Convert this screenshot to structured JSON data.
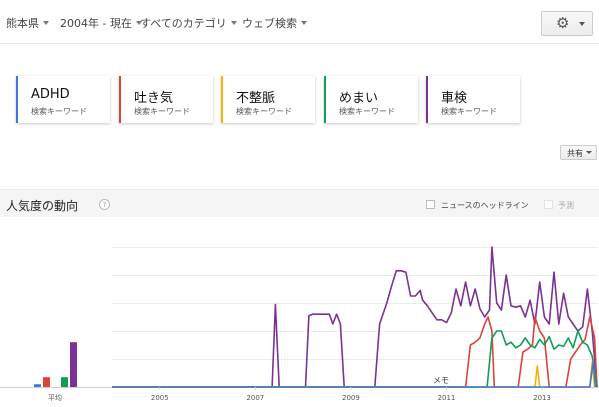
{
  "filters": [
    {
      "label": "熊本県"
    },
    {
      "label": "2004年 - 現在"
    },
    {
      "label": "すべてのカテゴリ"
    },
    {
      "label": "ウェブ検索"
    }
  ],
  "settings": {
    "icon": "gear-icon"
  },
  "terms": [
    {
      "term": "ADHD",
      "type": "検索キーワード",
      "color": "#3c78d8"
    },
    {
      "term": "吐き気",
      "type": "検索キーワード",
      "color": "#db4437"
    },
    {
      "term": "不整脈",
      "type": "検索キーワード",
      "color": "#f4b400"
    },
    {
      "term": "めまい",
      "type": "検索キーワード",
      "color": "#0f9d58"
    },
    {
      "term": "車検",
      "type": "検索キーワード",
      "color": "#7b3294"
    }
  ],
  "share": {
    "label": "共有"
  },
  "interest": {
    "title": "人気度の動向",
    "help": "?",
    "news_label": "ニュースのヘッドライン",
    "forecast_label": "予測"
  },
  "chart_data": {
    "type": "line",
    "x_ticks": [
      "2005",
      "2007",
      "2009",
      "2011",
      "2013"
    ],
    "average_label": "平均",
    "memo_label": "メモ",
    "ylim": [
      0,
      100
    ],
    "grid": true,
    "averages": [
      {
        "name": "ADHD",
        "value": 2
      },
      {
        "name": "吐き気",
        "value": 7
      },
      {
        "name": "不整脈",
        "value": 0
      },
      {
        "name": "めまい",
        "value": 7
      },
      {
        "name": "車検",
        "value": 32
      }
    ],
    "series": [
      {
        "name": "車検",
        "color": "#7b3294",
        "points": [
          [
            2004.0,
            0
          ],
          [
            2007.35,
            0
          ],
          [
            2007.42,
            59
          ],
          [
            2007.5,
            0
          ],
          [
            2008.05,
            0
          ],
          [
            2008.12,
            51
          ],
          [
            2008.2,
            52
          ],
          [
            2008.45,
            52
          ],
          [
            2008.55,
            52
          ],
          [
            2008.62,
            45
          ],
          [
            2008.7,
            52
          ],
          [
            2008.78,
            45
          ],
          [
            2008.86,
            0
          ],
          [
            2009.5,
            0
          ],
          [
            2009.6,
            45
          ],
          [
            2009.75,
            60
          ],
          [
            2009.85,
            72
          ],
          [
            2009.95,
            83
          ],
          [
            2010.05,
            83
          ],
          [
            2010.15,
            82
          ],
          [
            2010.25,
            65
          ],
          [
            2010.35,
            65
          ],
          [
            2010.45,
            69
          ],
          [
            2010.5,
            62
          ],
          [
            2010.6,
            58
          ],
          [
            2010.7,
            53
          ],
          [
            2010.8,
            48
          ],
          [
            2010.9,
            48
          ],
          [
            2011.0,
            46
          ],
          [
            2011.1,
            53
          ],
          [
            2011.2,
            70
          ],
          [
            2011.3,
            58
          ],
          [
            2011.4,
            75
          ],
          [
            2011.5,
            58
          ],
          [
            2011.6,
            70
          ],
          [
            2011.7,
            56
          ],
          [
            2011.8,
            50
          ],
          [
            2011.9,
            55
          ],
          [
            2011.95,
            100
          ],
          [
            2012.05,
            60
          ],
          [
            2012.15,
            55
          ],
          [
            2012.25,
            80
          ],
          [
            2012.35,
            58
          ],
          [
            2012.45,
            57
          ],
          [
            2012.55,
            58
          ],
          [
            2012.65,
            50
          ],
          [
            2012.75,
            62
          ],
          [
            2012.85,
            45
          ],
          [
            2012.95,
            75
          ],
          [
            2013.05,
            50
          ],
          [
            2013.15,
            45
          ],
          [
            2013.25,
            82
          ],
          [
            2013.35,
            45
          ],
          [
            2013.45,
            67
          ],
          [
            2013.55,
            50
          ],
          [
            2013.65,
            45
          ],
          [
            2013.75,
            40
          ],
          [
            2013.85,
            43
          ],
          [
            2013.95,
            70
          ],
          [
            2014.05,
            40
          ],
          [
            2014.15,
            0
          ]
        ]
      },
      {
        "name": "吐き気",
        "color": "#db4437",
        "points": [
          [
            2004.0,
            0
          ],
          [
            2011.4,
            0
          ],
          [
            2011.5,
            30
          ],
          [
            2011.6,
            32
          ],
          [
            2011.7,
            35
          ],
          [
            2011.8,
            45
          ],
          [
            2011.87,
            50
          ],
          [
            2011.95,
            40
          ],
          [
            2012.0,
            0
          ],
          [
            2012.5,
            0
          ],
          [
            2012.6,
            25
          ],
          [
            2012.7,
            27
          ],
          [
            2012.8,
            30
          ],
          [
            2012.85,
            50
          ],
          [
            2012.95,
            40
          ],
          [
            2013.05,
            35
          ],
          [
            2013.15,
            0
          ],
          [
            2013.5,
            0
          ],
          [
            2013.6,
            20
          ],
          [
            2013.7,
            25
          ],
          [
            2013.8,
            30
          ],
          [
            2013.9,
            34
          ],
          [
            2014.0,
            50
          ],
          [
            2014.1,
            35
          ],
          [
            2014.15,
            0
          ]
        ]
      },
      {
        "name": "めまい",
        "color": "#0f9d58",
        "points": [
          [
            2004.0,
            0
          ],
          [
            2011.85,
            0
          ],
          [
            2011.95,
            35
          ],
          [
            2012.05,
            40
          ],
          [
            2012.15,
            40
          ],
          [
            2012.25,
            30
          ],
          [
            2012.35,
            32
          ],
          [
            2012.45,
            28
          ],
          [
            2012.55,
            30
          ],
          [
            2012.65,
            35
          ],
          [
            2012.75,
            30
          ],
          [
            2012.85,
            28
          ],
          [
            2012.95,
            34
          ],
          [
            2013.05,
            30
          ],
          [
            2013.15,
            36
          ],
          [
            2013.25,
            27
          ],
          [
            2013.35,
            30
          ],
          [
            2013.45,
            29
          ],
          [
            2013.55,
            35
          ],
          [
            2013.65,
            28
          ],
          [
            2013.75,
            40
          ],
          [
            2013.85,
            32
          ],
          [
            2013.95,
            30
          ],
          [
            2014.05,
            22
          ],
          [
            2014.15,
            0
          ]
        ]
      },
      {
        "name": "不整脈",
        "color": "#f4b400",
        "points": [
          [
            2004.0,
            0
          ],
          [
            2012.85,
            0
          ],
          [
            2012.9,
            15
          ],
          [
            2012.95,
            0
          ],
          [
            2014.0,
            0
          ],
          [
            2014.05,
            18
          ],
          [
            2014.1,
            0
          ]
        ]
      },
      {
        "name": "ADHD",
        "color": "#3c78d8",
        "points": [
          [
            2004.0,
            0
          ],
          [
            2014.0,
            0
          ],
          [
            2014.07,
            18
          ],
          [
            2014.12,
            0
          ]
        ]
      }
    ]
  }
}
